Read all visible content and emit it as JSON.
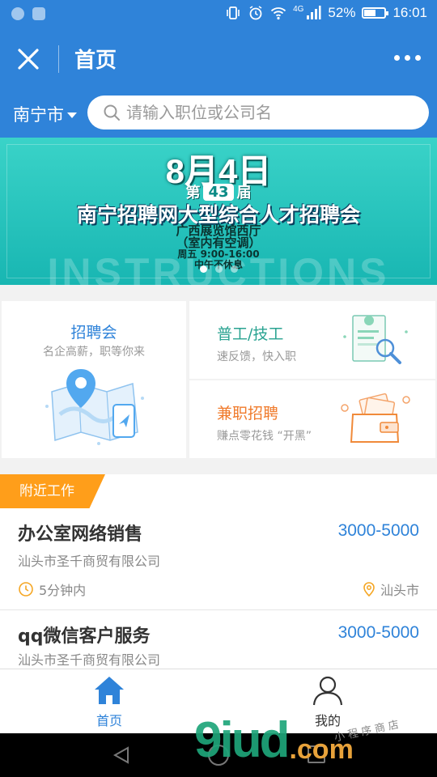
{
  "status_bar": {
    "network": "4G",
    "battery": "52%",
    "battery_level": 0.52,
    "time": "16:01"
  },
  "header": {
    "title": "首页",
    "close_icon": "close-icon",
    "more_icon": "more-icon"
  },
  "search": {
    "city": "南宁市",
    "placeholder": "请输入职位或公司名"
  },
  "banner": {
    "date": "8月4日",
    "session_prefix": "第",
    "session_number": "43",
    "session_suffix": "届",
    "fair_title": "南宁招聘网大型综合人才招聘会",
    "venue_line1": "广西展览馆西厅",
    "venue_line2": "（室内有空调）",
    "time_line1": "周五  9:00-16:00",
    "time_line2": "中午不休息",
    "watermark": "INSTRUCTIONS",
    "slide_count": 3,
    "active_slide": 0
  },
  "categories": {
    "fair": {
      "title": "招聘会",
      "subtitle": "名企高薪，职等你来",
      "icon": "map-pin-illustration"
    },
    "labor": {
      "title": "普工/技工",
      "subtitle": "速反馈，快入职",
      "icon": "resume-search-illustration"
    },
    "part_time": {
      "title": "兼职招聘",
      "subtitle": "赚点零花钱 “开黑”",
      "icon": "wallet-money-illustration"
    }
  },
  "nearby": {
    "tag": "附近工作",
    "jobs": [
      {
        "title": "办公室网络销售",
        "salary": "3000-5000",
        "company": "汕头市圣千商贸有限公司",
        "posted": "5分钟内",
        "location": "汕头市"
      },
      {
        "title": "qq微信客户服务",
        "salary": "3000-5000",
        "company": "汕头市圣千商贸有限公司"
      }
    ]
  },
  "tabbar": {
    "home": "首页",
    "mine": "我的"
  },
  "watermark": {
    "brand": "9iud",
    "suffix": ".com",
    "text": "小程序商店"
  },
  "colors": {
    "primary": "#2f83d9",
    "orange": "#ff9e1a",
    "teal": "#2aa391",
    "part_time": "#f07b2c"
  }
}
